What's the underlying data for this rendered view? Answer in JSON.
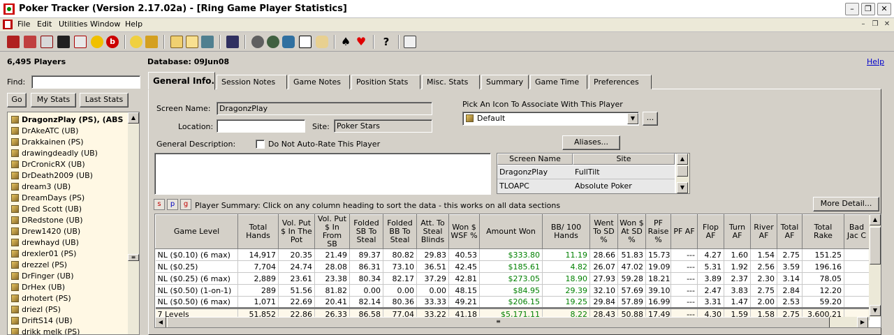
{
  "window": {
    "title": "Poker Tracker (Version 2.17.02a) - [Ring Game Player Statistics]"
  },
  "menu": {
    "file": "File",
    "edit": "Edit",
    "utilities": "Utilities",
    "window": "Window",
    "help": "Help"
  },
  "left": {
    "players_count": "6,495 Players",
    "find_label": "Find:",
    "find_value": "",
    "go": "Go",
    "my_stats": "My Stats",
    "last_stats": "Last Stats",
    "players": [
      "DragonzPlay (PS), (ABS",
      "DrAkeATC (UB)",
      "Drakkainen (PS)",
      "drawingdeadly (UB)",
      "DrCronicRX (UB)",
      "DrDeath2009 (UB)",
      "dream3 (UB)",
      "DreamDays (PS)",
      "Dred Scott (UB)",
      "DRedstone (UB)",
      "Drew1420 (UB)",
      "drewhayd (UB)",
      "drexler01 (PS)",
      "drezzel (PS)",
      "DrFinger (UB)",
      "DrHex (UB)",
      "drhotert (PS)",
      "driezl (PS)",
      "DriftS14 (UB)",
      "drikk melk (PS)"
    ]
  },
  "database": "Database: 09Jun08",
  "help_link": "Help",
  "tabs": [
    "General Info.",
    "Session Notes",
    "Game Notes",
    "Position Stats",
    "Misc. Stats",
    "Summary",
    "Game Time",
    "Preferences"
  ],
  "general": {
    "screen_name_label": "Screen Name:",
    "screen_name": "DragonzPlay",
    "location_label": "Location:",
    "location": "",
    "site_label": "Site:",
    "site": "Poker Stars",
    "icon_label": "Pick An Icon To Associate With This Player",
    "icon_value": "Default",
    "ellipsis": "...",
    "aliases": "Aliases...",
    "description_label": "General Description:",
    "no_autorate": "Do Not Auto-Rate This Player",
    "alias_headers": [
      "Screen Name",
      "Site"
    ],
    "alias_rows": [
      [
        "DragonzPlay",
        "FullTilt"
      ],
      [
        "TLOAPC",
        "Absolute Poker"
      ]
    ]
  },
  "summary": {
    "buttons": [
      "s",
      "p",
      "g"
    ],
    "text": "Player Summary: Click on any column heading to sort the data - this works on all data sections",
    "more_detail": "More Detail..."
  },
  "table": {
    "headers": [
      "Game Level",
      "Total Hands",
      "Vol. Put $ In The Pot",
      "Vol. Put $ In From SB",
      "Folded SB To Steal",
      "Folded BB To Steal",
      "Att. To Steal Blinds",
      "Won $ WSF %",
      "Amount Won",
      "BB/ 100 Hands",
      "Went To SD %",
      "Won $ At SD %",
      "PF Raise %",
      "PF AF",
      "Flop AF",
      "Turn AF",
      "River AF",
      "Total AF",
      "Total Rake",
      "Bad Jac C"
    ],
    "rows": [
      [
        "NL ($0.10) (6 max)",
        "14,917",
        "20.35",
        "21.49",
        "89.37",
        "80.82",
        "29.83",
        "40.53",
        "$333.80",
        "11.19",
        "28.66",
        "51.83",
        "15.73",
        "---",
        "4.27",
        "1.60",
        "1.54",
        "2.75",
        "151.25",
        ""
      ],
      [
        "NL ($0.25)",
        "7,704",
        "24.74",
        "28.08",
        "86.31",
        "73.10",
        "36.51",
        "42.45",
        "$185.61",
        "4.82",
        "26.07",
        "47.02",
        "19.09",
        "---",
        "5.31",
        "1.92",
        "2.56",
        "3.59",
        "196.16",
        ""
      ],
      [
        "NL ($0.25) (6 max)",
        "2,889",
        "23.61",
        "23.38",
        "80.34",
        "82.17",
        "37.29",
        "42.81",
        "$273.05",
        "18.90",
        "27.93",
        "59.28",
        "18.21",
        "---",
        "3.89",
        "2.37",
        "2.30",
        "3.14",
        "78.05",
        ""
      ],
      [
        "NL ($0.50) (1-on-1)",
        "289",
        "51.56",
        "81.82",
        "0.00",
        "0.00",
        "0.00",
        "48.15",
        "$84.95",
        "29.39",
        "32.10",
        "57.69",
        "39.10",
        "---",
        "2.47",
        "3.83",
        "2.75",
        "2.84",
        "12.20",
        ""
      ],
      [
        "NL ($0.50) (6 max)",
        "1,071",
        "22.69",
        "20.41",
        "82.14",
        "80.36",
        "33.33",
        "49.21",
        "$206.15",
        "19.25",
        "29.84",
        "57.89",
        "16.99",
        "---",
        "3.31",
        "1.47",
        "2.00",
        "2.53",
        "59.20",
        ""
      ]
    ],
    "total": [
      "7 Levels",
      "51,852",
      "22.86",
      "26.33",
      "86.58",
      "77.04",
      "33.22",
      "41.18",
      "$5,171.11",
      "8.22",
      "28.43",
      "50.88",
      "17.49",
      "---",
      "4.30",
      "1.59",
      "1.58",
      "2.75",
      "3,600.21",
      ""
    ]
  },
  "colors": {
    "positive": "#008000",
    "tab_bg": "#d4d0c8"
  }
}
